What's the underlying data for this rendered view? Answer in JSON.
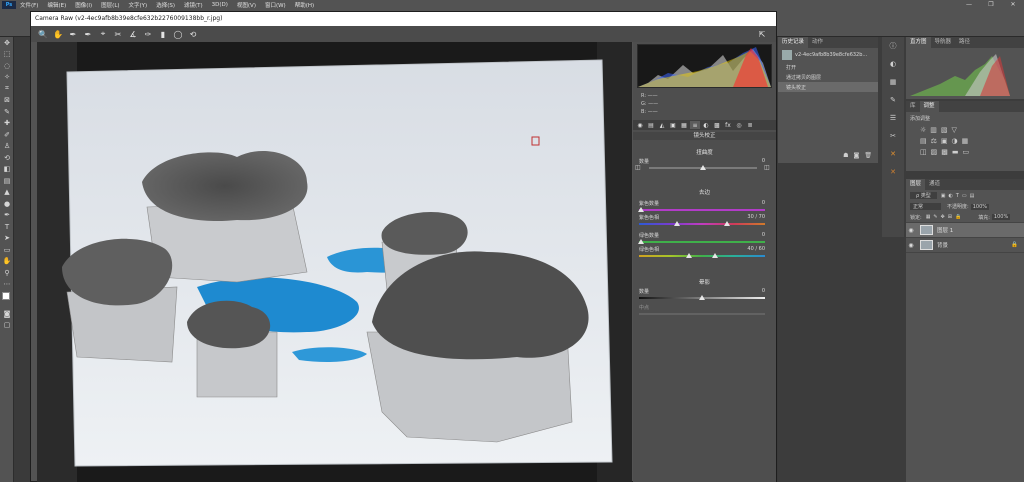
{
  "app": {
    "logo": "Ps"
  },
  "menubar": {
    "items": [
      "文件(F)",
      "编辑(E)",
      "图像(I)",
      "图层(L)",
      "文字(Y)",
      "选择(S)",
      "滤镜(T)",
      "3D(D)",
      "视图(V)",
      "窗口(W)",
      "帮助(H)"
    ],
    "window_controls": [
      "—",
      "❐",
      "✕"
    ]
  },
  "acr": {
    "title": "Camera Raw (v2-4ec9afb8b39e8cfe632b2276009138bb_r.jpg)",
    "tools": [
      "🔍",
      "✋",
      "✒",
      "✒",
      "⌖",
      "✂",
      "∡",
      "✑",
      "▮",
      "◯",
      "⟲"
    ],
    "open_icon": "⇱",
    "tabs": [
      "◉",
      "▤",
      "◭",
      "▣",
      "▦",
      "≡",
      "◐",
      "▩",
      "fx",
      "◎",
      "≣",
      "☰"
    ],
    "readouts": [
      "R: ——",
      "G: ——",
      "B: ——"
    ],
    "panel_title": "镜头校正",
    "distortion": {
      "title": "扭曲度",
      "amount_label": "数量",
      "amount_value": "0"
    },
    "fringe": {
      "title": "去边",
      "purple_amount_label": "紫色数量",
      "purple_amount_value": "0",
      "purple_hue_label": "紫色色相",
      "purple_hue_value": "30 / 70",
      "green_amount_label": "绿色数量",
      "green_amount_value": "0",
      "green_hue_label": "绿色色相",
      "green_hue_value": "40 / 60"
    },
    "vignette": {
      "title": "晕影",
      "amount_label": "数量",
      "amount_value": "0",
      "midpoint_label": "中点"
    }
  },
  "history": {
    "tabs": [
      "历史记录",
      "动作"
    ],
    "snapshot": "v2-4ec9afb8b39e8cfe632b...",
    "items": [
      "打开",
      "通过拷贝的图层",
      "镜头校正"
    ],
    "selected_index": 2,
    "footer_icons": [
      "☗",
      "◙",
      "🗑"
    ]
  },
  "navigator": {
    "tabs": [
      "直方图",
      "导航器",
      "路径"
    ]
  },
  "adjustments": {
    "tabs": [
      "库",
      "调整"
    ],
    "add_label": "添加调整"
  },
  "layers": {
    "tabs": [
      "图层",
      "通道"
    ],
    "kind_label": "ρ 类型",
    "blend_mode": "正常",
    "opacity_label": "不透明度:",
    "opacity_value": "100%",
    "lock_label": "锁定:",
    "fill_label": "填充:",
    "fill_value": "100%",
    "items": [
      {
        "name": "图层 1",
        "selected": true
      },
      {
        "name": "背景",
        "selected": false
      }
    ]
  },
  "colors": {
    "purple": "#b23cc8",
    "green": "#3fb04a",
    "accent_blue": "#31a8ff",
    "water": "#1e8ad0"
  },
  "icons": [
    "move-icon",
    "marquee-icon",
    "lasso-icon",
    "magic-wand-icon",
    "crop-icon",
    "eyedropper-icon",
    "healing-icon",
    "brush-icon",
    "stamp-icon",
    "history-brush-icon",
    "eraser-icon",
    "gradient-icon",
    "blur-icon",
    "dodge-icon",
    "pen-icon",
    "type-icon",
    "path-select-icon",
    "shape-icon",
    "hand-icon",
    "zoom-icon"
  ]
}
